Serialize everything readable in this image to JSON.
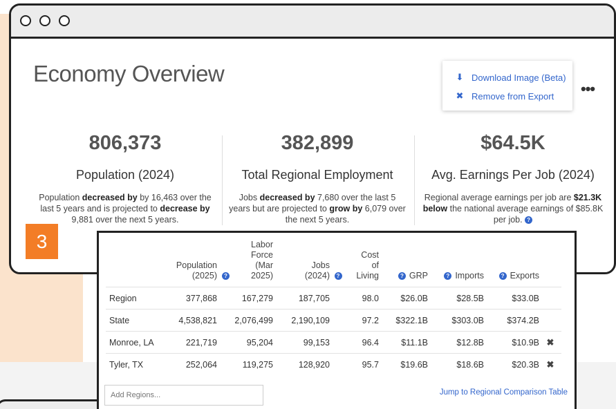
{
  "page": {
    "title": "Economy Overview"
  },
  "export_menu": {
    "items": [
      {
        "label": "Download Image (Beta)",
        "icon": "download-icon"
      },
      {
        "label": "Remove from Export",
        "icon": "close-icon"
      }
    ]
  },
  "stats": [
    {
      "value": "806,373",
      "label": "Population (2024)",
      "desc": [
        "Population ",
        "decreased by",
        " by 16,463 over the last 5 years and is projected to ",
        "decrease by",
        " 9,881 over the next 5 years."
      ]
    },
    {
      "value": "382,899",
      "label": "Total Regional Employment",
      "desc": [
        "Jobs ",
        "decreased by",
        " 7,680 over the last 5 years but are projected to ",
        "grow by",
        " 6,079 over the next 5 years."
      ]
    },
    {
      "value": "$64.5K",
      "label": "Avg. Earnings Per Job (2024)",
      "desc": [
        "Regional average earnings per job are ",
        "$21.3K below",
        " the national average earnings of $85.8K per job."
      ]
    }
  ],
  "badge": "3",
  "table": {
    "headers": {
      "population": [
        "Population",
        "(2025)"
      ],
      "labor_force": [
        "Labor",
        "Force",
        "(Mar",
        "2025)"
      ],
      "jobs": [
        "Jobs",
        "(2024)"
      ],
      "cost_of_living": [
        "Cost",
        "of",
        "Living"
      ],
      "grp": "GRP",
      "imports": "Imports",
      "exports": "Exports"
    },
    "rows": [
      {
        "name": "Region",
        "population": "377,868",
        "labor_force": "167,279",
        "jobs": "187,705",
        "col": "98.0",
        "grp": "$26.0B",
        "imports": "$28.5B",
        "exports": "$33.0B",
        "removable": false
      },
      {
        "name": "State",
        "population": "4,538,821",
        "labor_force": "2,076,499",
        "jobs": "2,190,109",
        "col": "97.2",
        "grp": "$322.1B",
        "imports": "$303.0B",
        "exports": "$374.2B",
        "removable": false
      },
      {
        "name": "Monroe, LA",
        "population": "221,719",
        "labor_force": "95,204",
        "jobs": "99,153",
        "col": "96.4",
        "grp": "$11.1B",
        "imports": "$12.8B",
        "exports": "$10.9B",
        "removable": true
      },
      {
        "name": "Tyler, TX",
        "population": "252,064",
        "labor_force": "119,275",
        "jobs": "128,920",
        "col": "95.7",
        "grp": "$19.6B",
        "imports": "$18.6B",
        "exports": "$20.3B",
        "removable": true
      }
    ],
    "add_regions_placeholder": "Add Regions...",
    "jump_link": "Jump to Regional Comparison Table",
    "remove_glyph": "✖"
  },
  "colors": {
    "accent": "#3366cc",
    "badge": "#f37d26",
    "peach": "#fbe3cc"
  }
}
